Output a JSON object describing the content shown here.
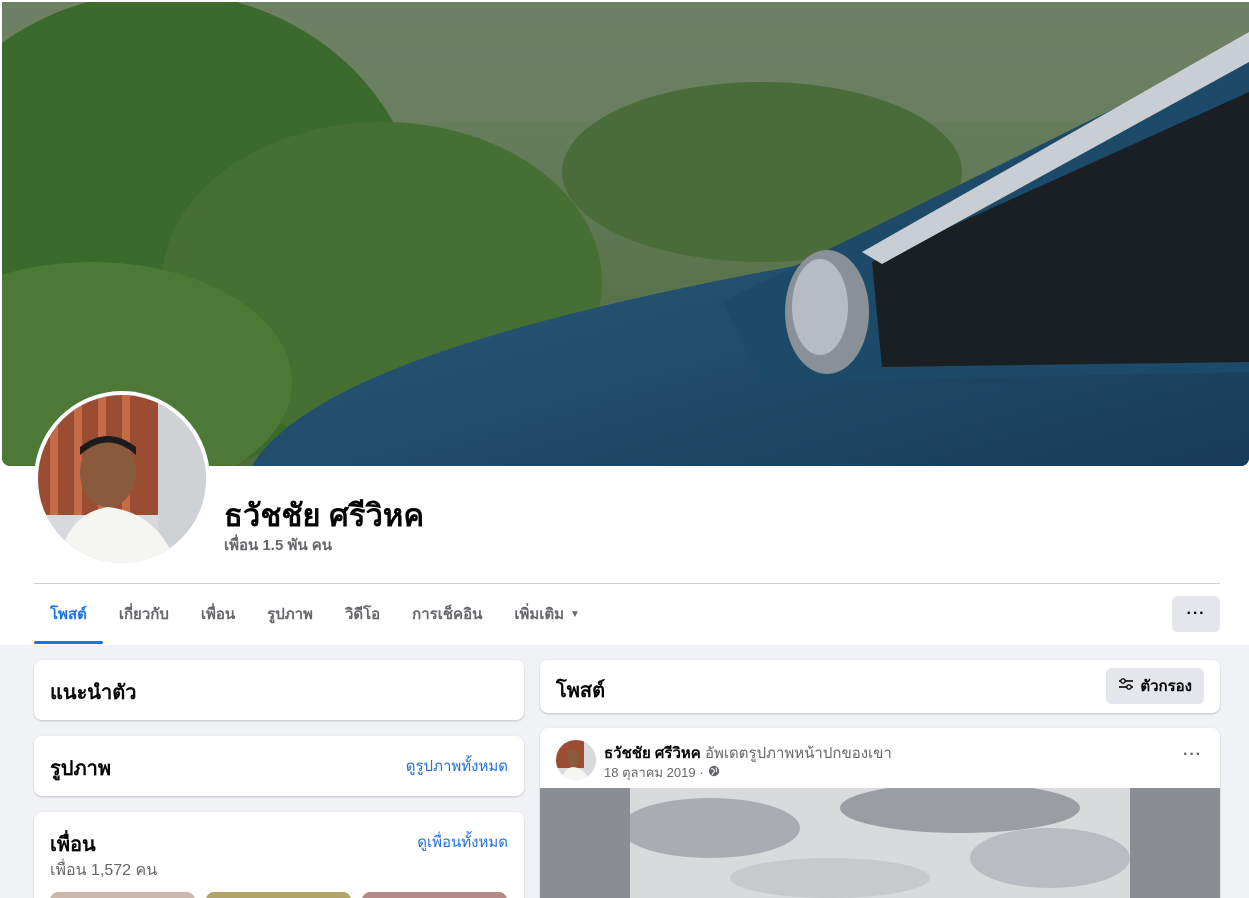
{
  "profile": {
    "name": "ธวัชชัย ศรีวิหค",
    "friends_summary": "เพื่อน 1.5 พัน คน"
  },
  "tabs": [
    {
      "label": "โพสต์",
      "active": true
    },
    {
      "label": "เกี่ยวกับ",
      "active": false
    },
    {
      "label": "เพื่อน",
      "active": false
    },
    {
      "label": "รูปภาพ",
      "active": false
    },
    {
      "label": "วิดีโอ",
      "active": false
    },
    {
      "label": "การเช็คอิน",
      "active": false
    },
    {
      "label": "เพิ่มเติม",
      "active": false
    }
  ],
  "more_button": "···",
  "intro": {
    "title": "แนะนำตัว"
  },
  "photos": {
    "title": "รูปภาพ",
    "link": "ดูรูปภาพทั้งหมด"
  },
  "friends": {
    "title": "เพื่อน",
    "link": "ดูเพื่อนทั้งหมด",
    "count_text": "เพื่อน 1,572 คน"
  },
  "posts": {
    "title": "โพสต์",
    "filter_label": "ตัวกรอง"
  },
  "post": {
    "author": "ธวัชชัย ศรีวิหค",
    "action": "อัพเดตรูปภาพหน้าปกของเขา",
    "date": "18 ตุลาคม 2019 ·",
    "more": "···"
  },
  "colors": {
    "accent": "#1b74e4",
    "link": "#216fdb",
    "background": "#f0f2f5",
    "secondary_text": "#65676b"
  },
  "icons": {
    "filter": "sliders-icon",
    "privacy": "globe-icon",
    "more": "ellipsis-icon",
    "dropdown": "caret-down-icon"
  }
}
